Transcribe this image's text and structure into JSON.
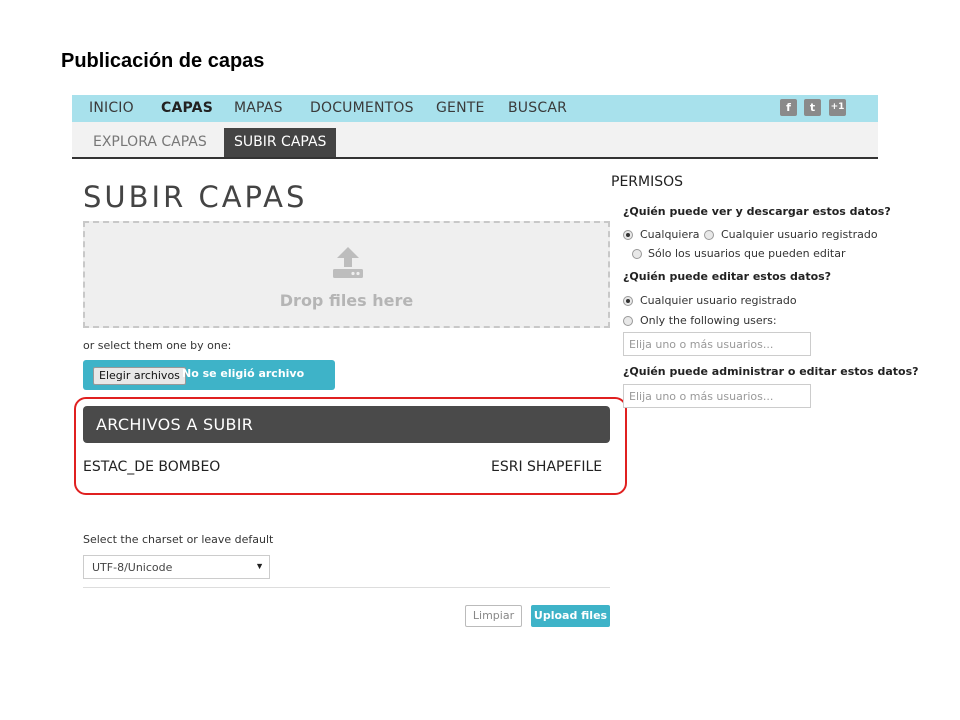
{
  "slide_title": "Publicación de capas",
  "nav": {
    "items": [
      "INICIO",
      "CAPAS",
      "MAPAS",
      "DOCUMENTOS",
      "GENTE",
      "BUSCAR"
    ],
    "active": "CAPAS",
    "social": {
      "facebook": "f",
      "twitter": "t",
      "gplus": "+1"
    }
  },
  "subtabs": {
    "explore": "EXPLORA CAPAS",
    "upload": "SUBIR CAPAS"
  },
  "heading": "SUBIR CAPAS",
  "dropzone": {
    "text": "Drop files here",
    "icon": "upload-icon"
  },
  "select_hint": "or select them one by one:",
  "file_input": {
    "button": "Elegir archivos",
    "status": "No se eligió archivo"
  },
  "files": {
    "header": "ARCHIVOS A SUBIR",
    "rows": [
      {
        "name": "ESTAC_DE BOMBEO",
        "type": "ESRI SHAPEFILE"
      }
    ]
  },
  "charset": {
    "label": "Select the charset or leave default",
    "value": "UTF-8/Unicode"
  },
  "buttons": {
    "clear": "Limpiar",
    "upload": "Upload files"
  },
  "permissions": {
    "title": "PERMISOS",
    "view": {
      "question": "¿Quién puede ver y descargar estos datos?",
      "options": [
        "Cualquiera",
        "Cualquier usuario registrado",
        "Sólo los usuarios que pueden editar"
      ],
      "selected": "Cualquiera"
    },
    "edit": {
      "question": "¿Quién puede editar estos datos?",
      "options": [
        "Cualquier usuario registrado",
        "Only the following users:"
      ],
      "selected": "Cualquier usuario registrado",
      "placeholder": "Elija uno o más usuarios..."
    },
    "admin": {
      "question": "¿Quién puede administrar o editar estos datos?",
      "placeholder": "Elija uno o más usuarios..."
    }
  },
  "colors": {
    "nav_bg": "#a8e1ec",
    "accent": "#3eb3c8",
    "highlight": "#e02020",
    "dark": "#4a4a4a"
  }
}
